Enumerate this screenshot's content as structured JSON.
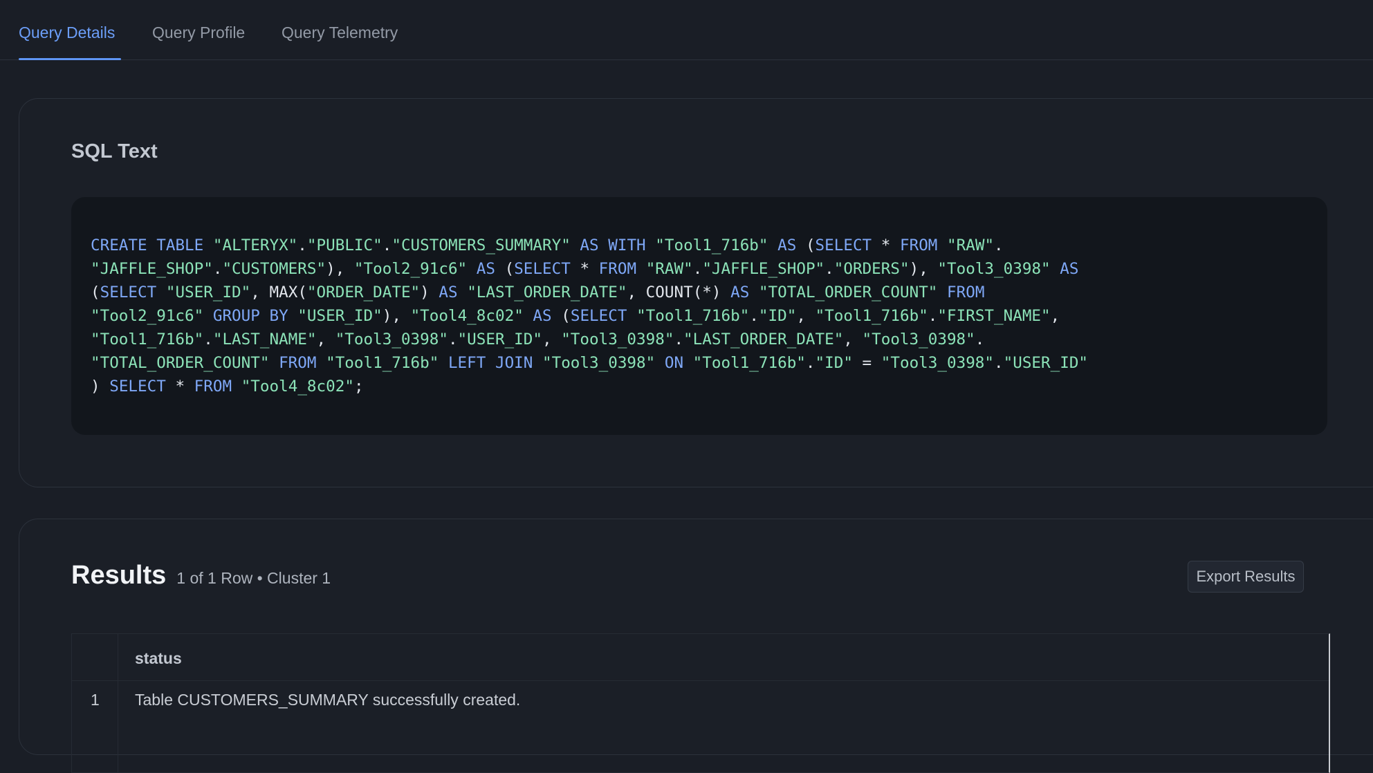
{
  "tabs": [
    {
      "label": "Query Details",
      "active": true
    },
    {
      "label": "Query Profile",
      "active": false
    },
    {
      "label": "Query Telemetry",
      "active": false
    }
  ],
  "sql_section": {
    "title": "SQL Text",
    "sql_text": "CREATE TABLE \"ALTERYX\".\"PUBLIC\".\"CUSTOMERS_SUMMARY\" AS WITH \"Tool1_716b\" AS (SELECT * FROM \"RAW\".\"JAFFLE_SHOP\".\"CUSTOMERS\"), \"Tool2_91c6\" AS (SELECT * FROM \"RAW\".\"JAFFLE_SHOP\".\"ORDERS\"), \"Tool3_0398\" AS (SELECT \"USER_ID\", MAX(\"ORDER_DATE\") AS \"LAST_ORDER_DATE\", COUNT(*) AS \"TOTAL_ORDER_COUNT\" FROM \"Tool2_91c6\" GROUP BY \"USER_ID\"), \"Tool4_8c02\" AS (SELECT \"Tool1_716b\".\"ID\", \"Tool1_716b\".\"FIRST_NAME\", \"Tool1_716b\".\"LAST_NAME\", \"Tool3_0398\".\"USER_ID\", \"Tool3_0398\".\"LAST_ORDER_DATE\", \"Tool3_0398\".\"TOTAL_ORDER_COUNT\" FROM \"Tool1_716b\" LEFT JOIN \"Tool3_0398\" ON \"Tool1_716b\".\"ID\" = \"Tool3_0398\".\"USER_ID\") SELECT * FROM \"Tool4_8c02\";"
  },
  "results": {
    "title": "Results",
    "meta": "1 of 1 Row • Cluster 1",
    "export_label": "Export Results",
    "columns": [
      "status"
    ],
    "rows": [
      {
        "num": "1",
        "cells": [
          "Table CUSTOMERS_SUMMARY successfully created."
        ]
      }
    ]
  },
  "colors": {
    "background": "#1a1e26",
    "accent": "#6c9ef8",
    "sql_keyword": "#7fa8f7",
    "sql_string": "#8ce3b8"
  }
}
